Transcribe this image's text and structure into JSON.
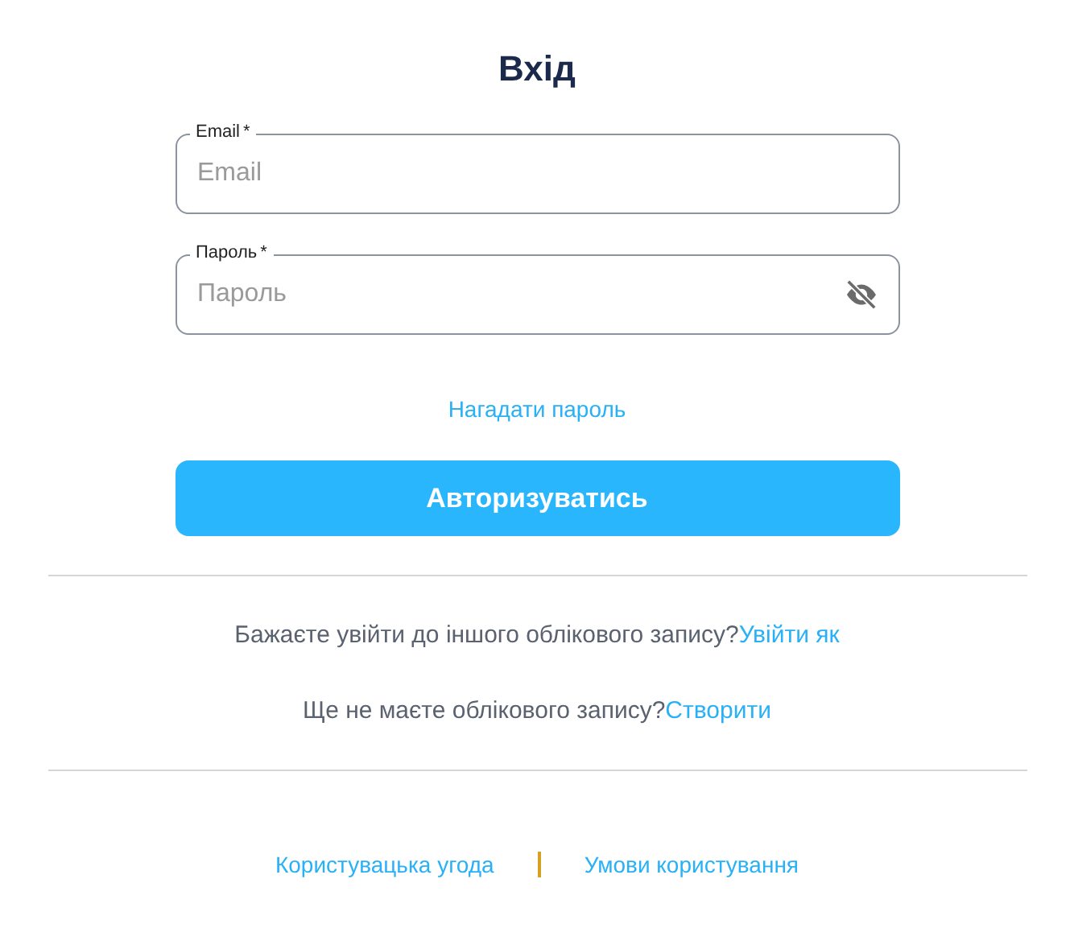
{
  "title": "Вхід",
  "fields": [
    {
      "label": "Email",
      "required_mark": "*",
      "placeholder": "Email",
      "kind": "text"
    },
    {
      "label": "Пароль",
      "required_mark": "*",
      "placeholder": "Пароль",
      "kind": "password",
      "password_visible": false
    }
  ],
  "forgot_link": "Нагадати пароль",
  "submit_button": "Авторизуватись",
  "prompts": [
    {
      "text": "Бажаєте увійти до іншого облікового запису?",
      "link": "Увійти як"
    },
    {
      "text": "Ще не маєте облікового запису?",
      "link": "Створити"
    }
  ],
  "footer_links": [
    "Користувацька угода",
    "Умови користування"
  ]
}
